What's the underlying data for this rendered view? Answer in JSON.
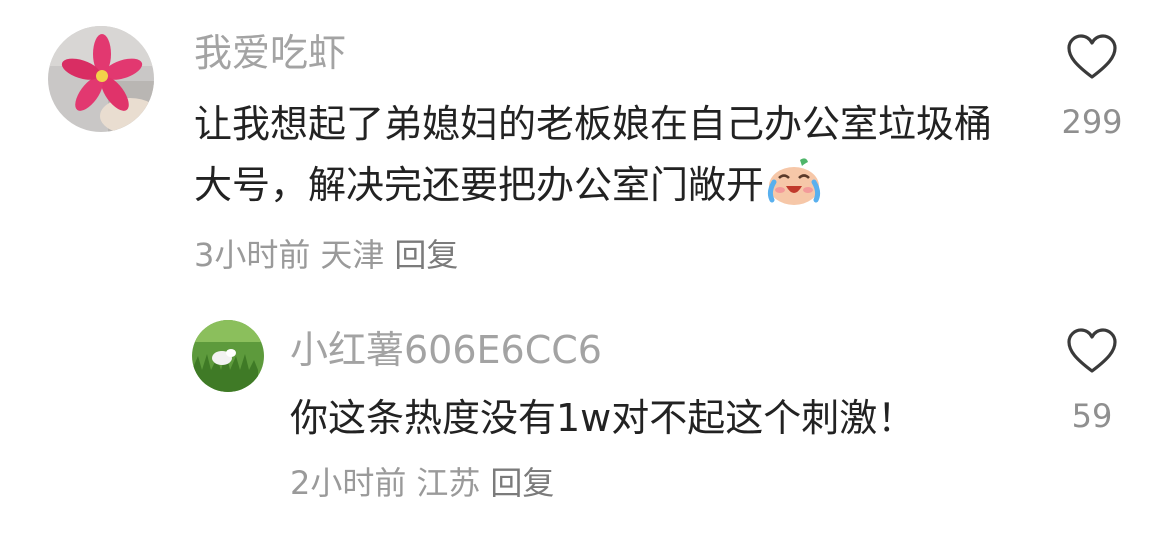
{
  "comments": [
    {
      "username": "我爱吃虾",
      "text": "让我想起了弟媳妇的老板娘在自己办公室垃圾桶大号，解决完还要把办公室门敞开",
      "emoji": "crying-laughing-emoji",
      "time": "3小时前",
      "location": "天津",
      "reply_label": "回复",
      "likes": "299",
      "avatar": "pink-flower-avatar"
    },
    {
      "username": "小红薯606E6CC6",
      "text": "你这条热度没有1w对不起这个刺激！",
      "time": "2小时前",
      "location": "江苏",
      "reply_label": "回复",
      "likes": "59",
      "avatar": "grass-rabbit-avatar"
    }
  ],
  "colors": {
    "username": "#a3a3a3",
    "text": "#222222",
    "meta": "#9a9a9a",
    "icon": "#3a3a3a"
  }
}
